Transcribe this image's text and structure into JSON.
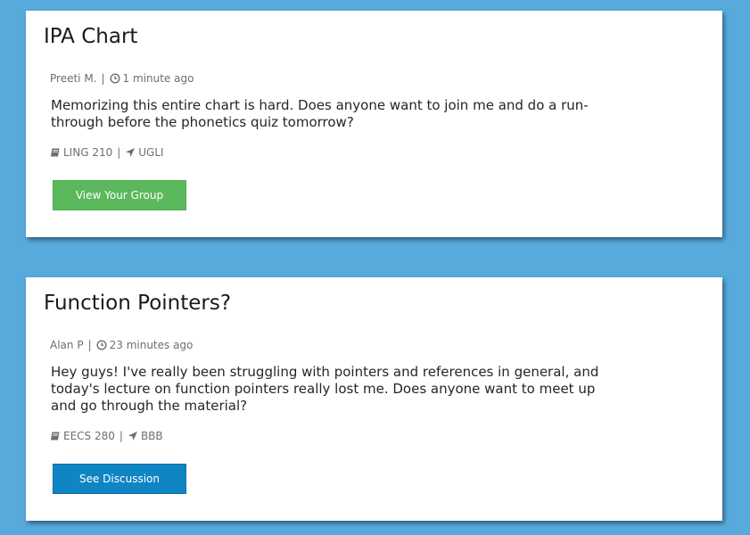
{
  "posts": [
    {
      "title": "IPA Chart",
      "author": "Preeti M.",
      "time": "1 minute ago",
      "body": "Memorizing this entire chart is hard. Does anyone want to join me and do a run-through before the phonetics quiz tomorrow?",
      "course": "LING 210",
      "location": "UGLI",
      "button_label": "View Your Group",
      "button_color": "#5cb85c"
    },
    {
      "title": "Function Pointers?",
      "author": "Alan P",
      "time": "23 minutes ago",
      "body": "Hey guys! I've really been struggling with pointers and references in general, and today's lecture on function pointers really lost me. Does anyone want to meet up and go through the material?",
      "course": "EECS 280",
      "location": "BBB",
      "button_label": "See Discussion",
      "button_color": "#0f85c4"
    }
  ],
  "icons": {
    "time": "clock-icon",
    "course": "book-icon",
    "location": "location-arrow-icon"
  },
  "background_color": "#58aadc"
}
